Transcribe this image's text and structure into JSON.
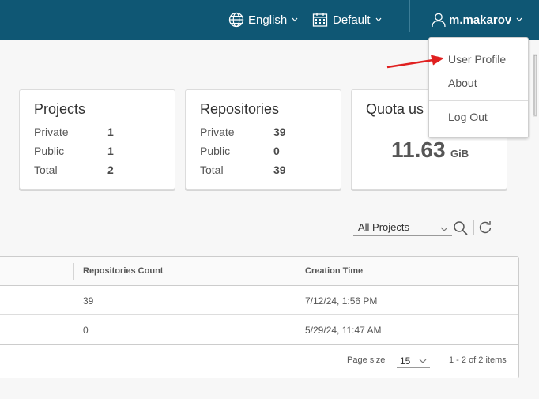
{
  "header": {
    "language": "English",
    "theme": "Default",
    "user": "m.makarov",
    "bg_color": "#0f5774"
  },
  "user_menu": {
    "items": [
      "User Profile",
      "About",
      "Log Out"
    ]
  },
  "cards": {
    "projects": {
      "title": "Projects",
      "rows": [
        {
          "label": "Private",
          "value": "1"
        },
        {
          "label": "Public",
          "value": "1"
        },
        {
          "label": "Total",
          "value": "2"
        }
      ]
    },
    "repositories": {
      "title": "Repositories",
      "rows": [
        {
          "label": "Private",
          "value": "39"
        },
        {
          "label": "Public",
          "value": "0"
        },
        {
          "label": "Total",
          "value": "39"
        }
      ]
    },
    "quota": {
      "title": "Quota us",
      "value": "11.63",
      "unit": "GiB"
    }
  },
  "toolbar": {
    "filter": "All Projects"
  },
  "table": {
    "columns": [
      "Repositories Count",
      "Creation Time"
    ],
    "rows": [
      {
        "repositories_count": "39",
        "creation_time": "7/12/24, 1:56 PM"
      },
      {
        "repositories_count": "0",
        "creation_time": "5/29/24, 11:47 AM"
      }
    ],
    "footer": {
      "page_size_label": "Page size",
      "page_size": "15",
      "range": "1 - 2 of 2 items"
    }
  },
  "icons": {
    "language": "globe-icon",
    "theme": "calendar-icon",
    "user": "user-icon",
    "search": "search-icon",
    "refresh": "refresh-icon"
  },
  "annotation": {
    "arrow_color": "#e02020"
  }
}
